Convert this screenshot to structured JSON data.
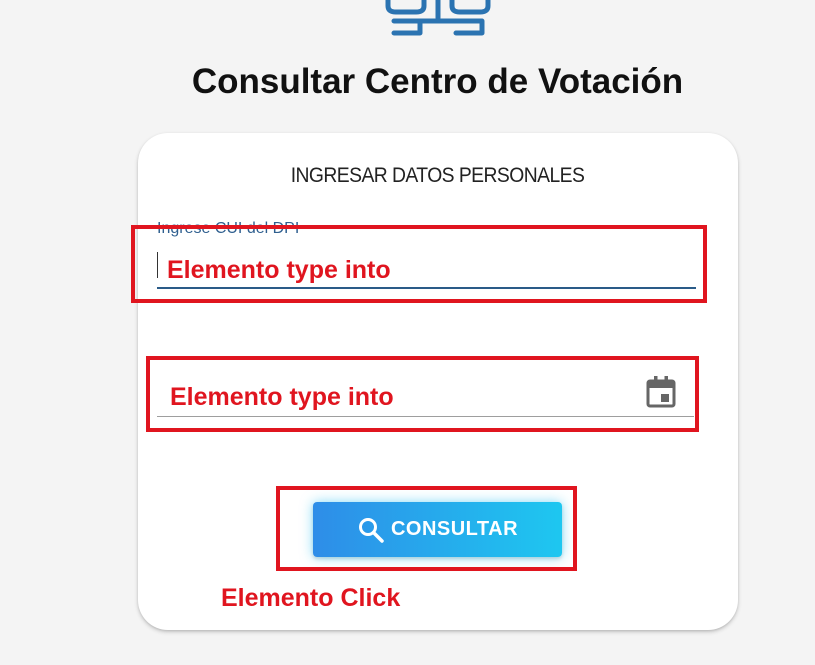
{
  "page": {
    "title": "Consultar Centro de Votación"
  },
  "form": {
    "heading": "INGRESAR DATOS PERSONALES",
    "cui_field": {
      "label": "Ingrese CUI del DPI",
      "value": ""
    },
    "date_field": {
      "value": "",
      "icon": "calendar-icon"
    },
    "submit": {
      "label": "CONSULTAR",
      "icon": "search-icon"
    }
  },
  "annotations": {
    "field1": "Elemento type into",
    "field2": "Elemento type into",
    "button": "Elemento Click",
    "color": "#e0151f"
  },
  "colors": {
    "button_gradient_start": "#2e8de8",
    "button_gradient_end": "#1ec7f0",
    "label": "#2f5f8f"
  }
}
